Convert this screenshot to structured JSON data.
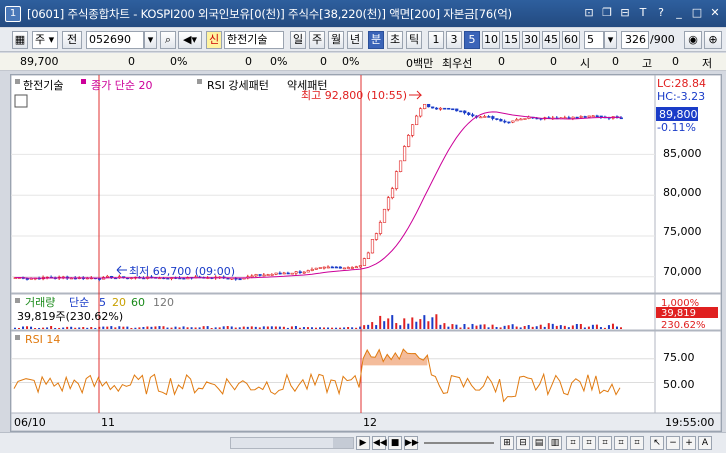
{
  "window": {
    "number": "1",
    "title": "[0601] 주식종합차트 - KOSPI200 외국인보유[0(천)] 주식수[38,220(천)] 액면[200] 자본금[76(억)",
    "buttons": [
      "⊡",
      "□",
      "⊟",
      "T",
      "?",
      "_",
      "□",
      "X"
    ]
  },
  "toolbar": {
    "market": "주",
    "prev_label": "전",
    "code": "052690",
    "name_tag": "신",
    "name": "한전기술",
    "periods": [
      "일",
      "주",
      "월",
      "년",
      "분",
      "초",
      "틱"
    ],
    "active_period": "분",
    "intervals": [
      "1",
      "3",
      "5",
      "10",
      "15",
      "30",
      "45",
      "60"
    ],
    "active_interval": "5",
    "interval_value": "5",
    "count": "326",
    "count_total": "/900",
    "icons": [
      "speaker-icon",
      "zoom-icon",
      "arrow-icon",
      "config-icon"
    ]
  },
  "infobar": {
    "price": "89,700",
    "change1": "0",
    "pct1": "0%",
    "change2": "0",
    "pct2": "0%",
    "volume": "0",
    "pct3": "0%",
    "amount": "0백만",
    "best_label": "최우선",
    "best1": "0",
    "best2": "0",
    "open_label": "시",
    "open_val": "0",
    "high_label": "고",
    "high_val": "0",
    "low_label": "저"
  },
  "chart": {
    "legend_name": "한전기술",
    "legend_ma": "종가 단순 20",
    "legend_rsi_pattern": "RSI 강세패턴",
    "legend_rsi_pattern2": "약세패턴",
    "high_annot": "최고 92,800 (10:55)",
    "low_annot": "최저 69,700 (09:00)",
    "lc": "LC:28.84",
    "hc": "HC:-3.23",
    "current_price": "89,800",
    "current_pct": "-0.11%",
    "price_axis": [
      "85,000",
      "80,000",
      "75,000",
      "70,000"
    ],
    "volume_label": "거래량",
    "volume_ma_label": "단순",
    "volume_ma": [
      "5",
      "20",
      "60",
      "120"
    ],
    "volume_value": "39,819주(230.62%)",
    "volume_axis_top": "1,000%",
    "volume_current": "39,819",
    "volume_pct": "230.62%",
    "rsi_label": "RSI 14",
    "rsi_axis": [
      "75.00",
      "50.00"
    ],
    "date_labels": [
      "06/10",
      "11",
      "12"
    ],
    "time_label": "19:55:00"
  },
  "colors": {
    "price_up": "#e02020",
    "price_down": "#1a3cc8",
    "ma": "#cc0099",
    "rsi": "#e07a10",
    "divider": "#e03030",
    "current_box": "#1a3cc8",
    "volume_box": "#e02020"
  },
  "chart_data": {
    "type": "candlestick",
    "price": {
      "ylim": [
        68500,
        94000
      ],
      "start": 69900,
      "day_breaks": [
        "11",
        "12"
      ],
      "low": 69700,
      "high": 92800,
      "last": 89800
    },
    "rsi": {
      "ylim": [
        20,
        100
      ],
      "lines": [
        75,
        50
      ]
    }
  }
}
